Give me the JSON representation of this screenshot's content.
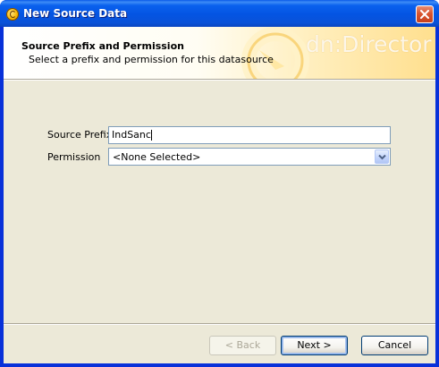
{
  "window": {
    "title": "New Source Data",
    "icon": "app-icon",
    "close_icon": "close-icon"
  },
  "banner": {
    "title": "Source Prefix and Permission",
    "subtitle": "Select a prefix and permission for this datasource",
    "brand": "dn:Director",
    "logo_icon": "dn-director-logo-icon"
  },
  "form": {
    "source_prefix": {
      "label": "Source Prefix",
      "value": "IndSanc"
    },
    "permission": {
      "label": "Permission",
      "selected": "<None Selected>",
      "arrow_icon": "chevron-down-icon"
    }
  },
  "buttons": {
    "back": "< Back",
    "next": "Next >",
    "cancel": "Cancel"
  },
  "colors": {
    "titlebar": "#0454e2",
    "client_bg": "#ece9d8",
    "banner_accent": "#ffdf8e",
    "input_border": "#7f9db9"
  }
}
